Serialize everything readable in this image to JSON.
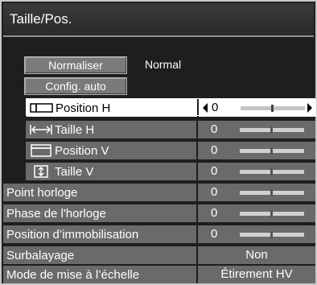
{
  "menu": {
    "title": "Taille/Pos."
  },
  "buttons": {
    "normalize": "Normaliser",
    "auto_setup": "Config. auto"
  },
  "status": {
    "mode": "Normal"
  },
  "rows": [
    {
      "label": "Position H",
      "value": "0",
      "icon": "position-h-icon",
      "selected": true
    },
    {
      "label": "Taille H",
      "value": "0",
      "icon": "size-h-icon"
    },
    {
      "label": "Position V",
      "value": "0",
      "icon": "position-v-icon"
    },
    {
      "label": "Taille V",
      "value": "0",
      "icon": "size-v-icon"
    },
    {
      "label": "Point horloge",
      "value": "0"
    },
    {
      "label": "Phase de l'horloge",
      "value": "0"
    },
    {
      "label": "Position d’immobilisation",
      "value": "0"
    },
    {
      "label": "Surbalayage",
      "value": "Non"
    },
    {
      "label": "Mode de mise à l’échelle",
      "value": "Étirement HV"
    }
  ],
  "colors": {
    "selected_bg": "#ffffff",
    "row_bg": "#6a6a6a",
    "panel_bg": "#1e1e1e"
  }
}
